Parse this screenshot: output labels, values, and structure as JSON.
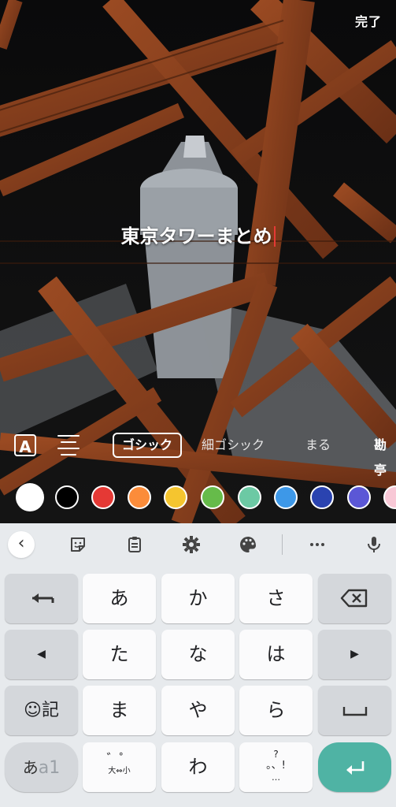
{
  "header": {
    "done_label": "完了"
  },
  "editor": {
    "text": "東京タワーまとめ"
  },
  "text_tools": {
    "style_icon": "text-style-icon",
    "align_icon": "align-center-icon",
    "fonts": [
      {
        "label": "ゴシック",
        "selected": true
      },
      {
        "label": "細ゴシック",
        "selected": false
      },
      {
        "label": "まる",
        "selected": false
      },
      {
        "label": "勘亭",
        "selected": false
      }
    ]
  },
  "colors": [
    "#ffffff",
    "#000000",
    "#e53935",
    "#fb8c3a",
    "#f5c52f",
    "#66bb4a",
    "#6cc9a4",
    "#3d98e8",
    "#2a43b0",
    "#5b57d6",
    "#f8c8d6"
  ],
  "keyboard": {
    "toolbar_icons": [
      "back-icon",
      "sticker-icon",
      "clipboard-icon",
      "settings-icon",
      "palette-icon",
      "more-icon",
      "mic-icon"
    ],
    "rows": [
      [
        "←",
        "あ",
        "か",
        "さ",
        "⌫"
      ],
      [
        "◀",
        "た",
        "な",
        "は",
        "▶"
      ],
      [
        "☺記",
        "ま",
        "や",
        "ら",
        "␣"
      ],
      [
        "あa1",
        "゛゜大⇔小",
        "わ",
        "、。?!",
        "↵"
      ]
    ],
    "mode_label_a": "あ",
    "mode_label_b": "a1",
    "dakuten_top": "゛゜",
    "dakuten_bottom": "大⇔小",
    "wa": "わ",
    "punct_top": "?",
    "punct_mid": "。、!",
    "punct_bottom": "…"
  },
  "accent_colors": {
    "enter": "#4fb3a4",
    "cursor": "#e53935"
  }
}
